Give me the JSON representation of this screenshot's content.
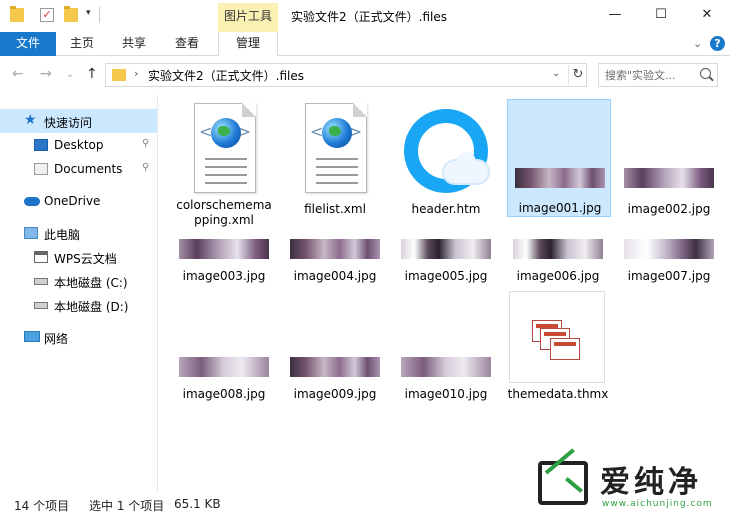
{
  "window": {
    "title": "实验文件2（正式文件）.files",
    "contextual_tab": "图片工具",
    "minimize": "—",
    "maximize": "☐",
    "close": "✕"
  },
  "ribbon": {
    "tabs": [
      "文件",
      "主页",
      "共享",
      "查看",
      "管理"
    ],
    "collapse": "⌄",
    "help": "?"
  },
  "address": {
    "path": "实验文件2（正式文件）.files",
    "separator": "›",
    "dropdown": "⌄",
    "refresh": "↻",
    "back": "←",
    "forward": "→",
    "recent": "⌄",
    "up": "↑"
  },
  "search": {
    "placeholder": "搜索\"实验文..."
  },
  "nav": {
    "items": [
      {
        "label": "快速访问",
        "pinned": false
      },
      {
        "label": "Desktop",
        "pinned": true
      },
      {
        "label": "Documents",
        "pinned": true
      },
      {
        "label": "OneDrive",
        "pinned": false
      },
      {
        "label": "此电脑",
        "pinned": false
      },
      {
        "label": "WPS云文档",
        "pinned": false
      },
      {
        "label": "本地磁盘 (C:)",
        "pinned": false
      },
      {
        "label": "本地磁盘 (D:)",
        "pinned": false
      },
      {
        "label": "网络",
        "pinned": false
      }
    ],
    "pin_glyph": "📌"
  },
  "files": [
    {
      "name": "colorschememapping.xml",
      "display": "colorschemema pping.xml",
      "type": "xml"
    },
    {
      "name": "filelist.xml",
      "type": "xml"
    },
    {
      "name": "header.htm",
      "type": "htm"
    },
    {
      "name": "image001.jpg",
      "type": "jpg",
      "selected": true
    },
    {
      "name": "image002.jpg",
      "type": "jpg"
    },
    {
      "name": "image003.jpg",
      "type": "jpg"
    },
    {
      "name": "image004.jpg",
      "type": "jpg"
    },
    {
      "name": "image005.jpg",
      "type": "jpg"
    },
    {
      "name": "image006.jpg",
      "type": "jpg"
    },
    {
      "name": "image007.jpg",
      "type": "jpg"
    },
    {
      "name": "image008.jpg",
      "type": "jpg"
    },
    {
      "name": "image009.jpg",
      "type": "jpg"
    },
    {
      "name": "image010.jpg",
      "type": "jpg"
    },
    {
      "name": "themedata.thmx",
      "type": "thmx"
    }
  ],
  "status": {
    "count": "14 个项目",
    "selection": "选中 1 个项目",
    "size": "65.1 KB"
  },
  "watermark": {
    "text": "爱纯净",
    "url": "www.aichunjing.com"
  },
  "colors": {
    "accent": "#1979ca",
    "selection": "#cce8ff",
    "context_tab": "#fbf0b3"
  }
}
